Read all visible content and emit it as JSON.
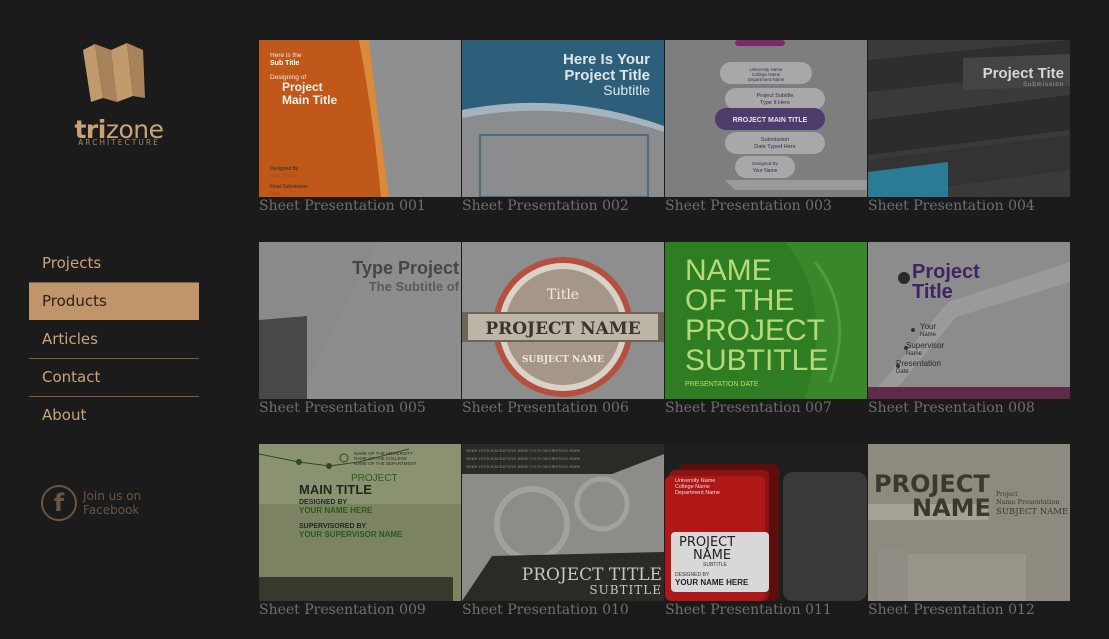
{
  "brand": {
    "name_bold": "tri",
    "name_rest": "zone",
    "subtitle": "ARCHITECTURE",
    "primary_color": "#c0956a"
  },
  "nav": {
    "items": [
      {
        "label": "Projects",
        "active": false
      },
      {
        "label": "Products",
        "active": true
      },
      {
        "label": "Articles",
        "active": false
      },
      {
        "label": "Contact",
        "active": false
      },
      {
        "label": "About",
        "active": false
      }
    ]
  },
  "social": {
    "icon": "facebook-icon",
    "line1": "Join us on",
    "line2": "Facebook"
  },
  "gallery": {
    "items": [
      {
        "caption": "Sheet Presentation 001",
        "pre_title": "Here is the",
        "sub_title": "Sub Title",
        "designing_of": "Designing of",
        "title_line1": "Project",
        "title_line2": "Main Title",
        "designed_by": "Designed By",
        "your_name": "Your Name",
        "final_submission": "Final Submission",
        "date": "Date"
      },
      {
        "caption": "Sheet Presentation 002",
        "title_line1": "Here Is Your",
        "title_line2": "Project Title",
        "subtitle": "Subtitle"
      },
      {
        "caption": "Sheet Presentation 003",
        "line1": "University Name",
        "line2": "College Name",
        "line3": "Department Name",
        "project_subtitle": "Project Subtitle",
        "type_it_here": "Type It Here",
        "main_title": "RROJECT MAIN TITLE",
        "submission": "Submission",
        "date_typed": "Date Typed Here",
        "designed_by": "Designed By",
        "your_name": "Your Name"
      },
      {
        "caption": "Sheet Presentation 004",
        "title": "Project Tite",
        "subtitle": "Submission"
      },
      {
        "caption": "Sheet Presentation 005",
        "title": "Type Project",
        "subtitle": "The Subtitle of"
      },
      {
        "caption": "Sheet Presentation 006",
        "badge_title": "Title",
        "ribbon": "PROJECT NAME",
        "badge_subject": "SUBJECT NAME"
      },
      {
        "caption": "Sheet Presentation 007",
        "line1": "NAME",
        "line2": "OF THE",
        "line3": "PROJECT",
        "line4": "SUBTITLE",
        "date": "PRESENTATION DATE"
      },
      {
        "caption": "Sheet Presentation 008",
        "title_line1": "Project",
        "title_line2": "Title",
        "your": "Your",
        "name": "Name",
        "supervisor": "Supervisor",
        "supervisor_name": "Name",
        "presentation": "Presentation",
        "date": "Date"
      },
      {
        "caption": "Sheet Presentation 009",
        "univ": "NAME OF THE UNIVERSITY",
        "college": "NAME OF THE COLLEGE",
        "dept": "NAME OF THE DEPARTMENT",
        "project": "PROJECT",
        "main_title": "MAIN TITLE",
        "designed_by": "DESIGNED BY",
        "your_name": "YOUR NAME HERE",
        "supervised_by": "SUPERVISORED BY",
        "supervisor_name": "YOUR SUPERVISOR NAME"
      },
      {
        "caption": "Sheet Presentation 010",
        "desc": "HERE YOUR DISCRIPTION HERE YOUR DISCRIPTION HERE",
        "title": "PROJECT TITLE",
        "subtitle": "SUBTITLE"
      },
      {
        "caption": "Sheet Presentation 011",
        "univ": "University Name",
        "college": "College Name",
        "dept": "Department Name",
        "project": "PROJECT",
        "name": "NAME",
        "subtitle": "SUBTITLE",
        "designed_by": "DESIGNED BY",
        "your_name": "YOUR NAME HERE"
      },
      {
        "caption": "Sheet Presentation 012",
        "project": "PROJECT",
        "name": "NAME",
        "project_name": "Project",
        "name_presentation": "Name Presentation",
        "subject": "SUBJECT NAME"
      }
    ]
  }
}
